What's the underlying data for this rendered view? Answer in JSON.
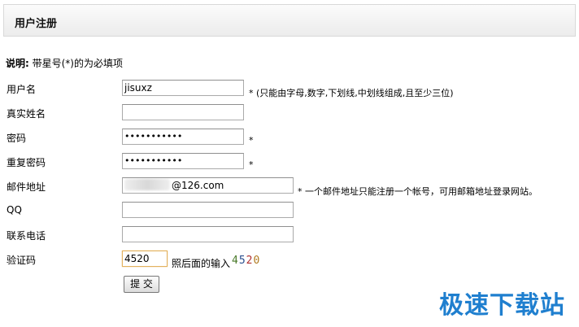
{
  "header": {
    "title": "用户注册"
  },
  "note": {
    "label": "说明:",
    "text": " 带星号(*)的为必填项"
  },
  "form": {
    "username": {
      "label": "用户名",
      "value": "jisuxz",
      "hint": "* (只能由字母,数字,下划线,中划线组成,且至少三位)"
    },
    "realname": {
      "label": "真实姓名",
      "value": ""
    },
    "password": {
      "label": "密码",
      "value": "•••••••••••",
      "star": "*"
    },
    "repeat_password": {
      "label": "重复密码",
      "value": "•••••••••••",
      "star": "*"
    },
    "email": {
      "label": "邮件地址",
      "value_suffix": "@126.com",
      "hint": "* 一个邮件地址只能注册一个帐号，可用邮箱地址登录网站。"
    },
    "qq": {
      "label": "QQ",
      "value": ""
    },
    "phone": {
      "label": "联系电话",
      "value": ""
    },
    "captcha": {
      "label": "验证码",
      "value": "4520",
      "instruction": "照后面的输入",
      "code_chars": [
        "4",
        "5",
        "2",
        "0"
      ],
      "code_colors": [
        "#4a7a2a",
        "#2a4f8f",
        "#b03030",
        "#b07a20"
      ]
    },
    "submit_label": "提 交"
  },
  "watermark": "极速下载站"
}
